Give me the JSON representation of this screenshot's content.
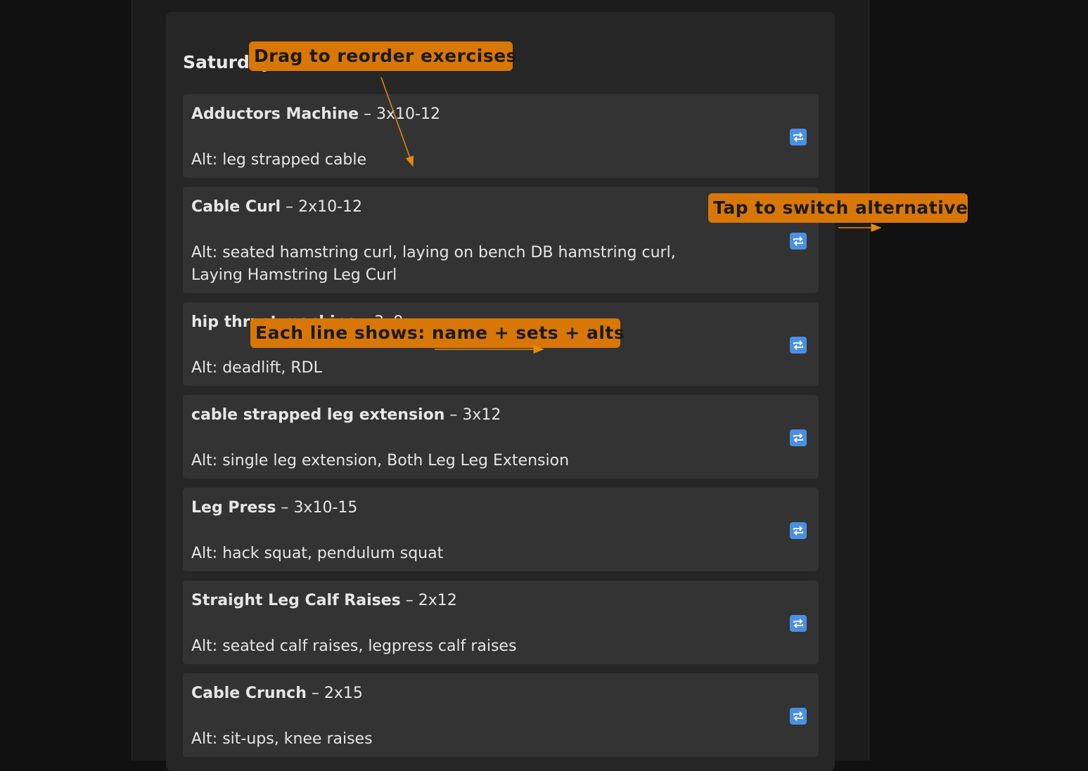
{
  "day": {
    "title": "Saturday"
  },
  "alt_prefix": "Alt: ",
  "sets_separator": " – ",
  "exercises": [
    {
      "name": "Adductors Machine",
      "sets": "3x10-12",
      "alt": "leg strapped cable"
    },
    {
      "name": "Cable Curl",
      "sets": "2x10-12",
      "alt": "seated hamstring curl, laying on bench DB hamstring curl, Laying Hamstring Leg Curl"
    },
    {
      "name": "hip thrust machine",
      "sets": "3x8",
      "alt": "deadlift, RDL"
    },
    {
      "name": "cable strapped leg extension",
      "sets": "3x12",
      "alt": "single leg extension, Both Leg Leg Extension"
    },
    {
      "name": "Leg Press",
      "sets": "3x10-15",
      "alt": "hack squat, pendulum squat"
    },
    {
      "name": "Straight Leg Calf Raises",
      "sets": "2x12",
      "alt": "seated calf raises, legpress calf raises"
    },
    {
      "name": "Cable Crunch",
      "sets": "2x15",
      "alt": "sit-ups, knee raises"
    }
  ],
  "swap_icon": "swap-arrows-icon",
  "annotations": {
    "drag": "Drag to reorder exercises",
    "tap": "Tap to switch alternative",
    "each_line": "Each line shows: name + sets + alts"
  },
  "colors": {
    "background": "#111111",
    "panel": "#262626",
    "card": "#333333",
    "accent": "#4a90e2",
    "callout": "#d97706"
  }
}
